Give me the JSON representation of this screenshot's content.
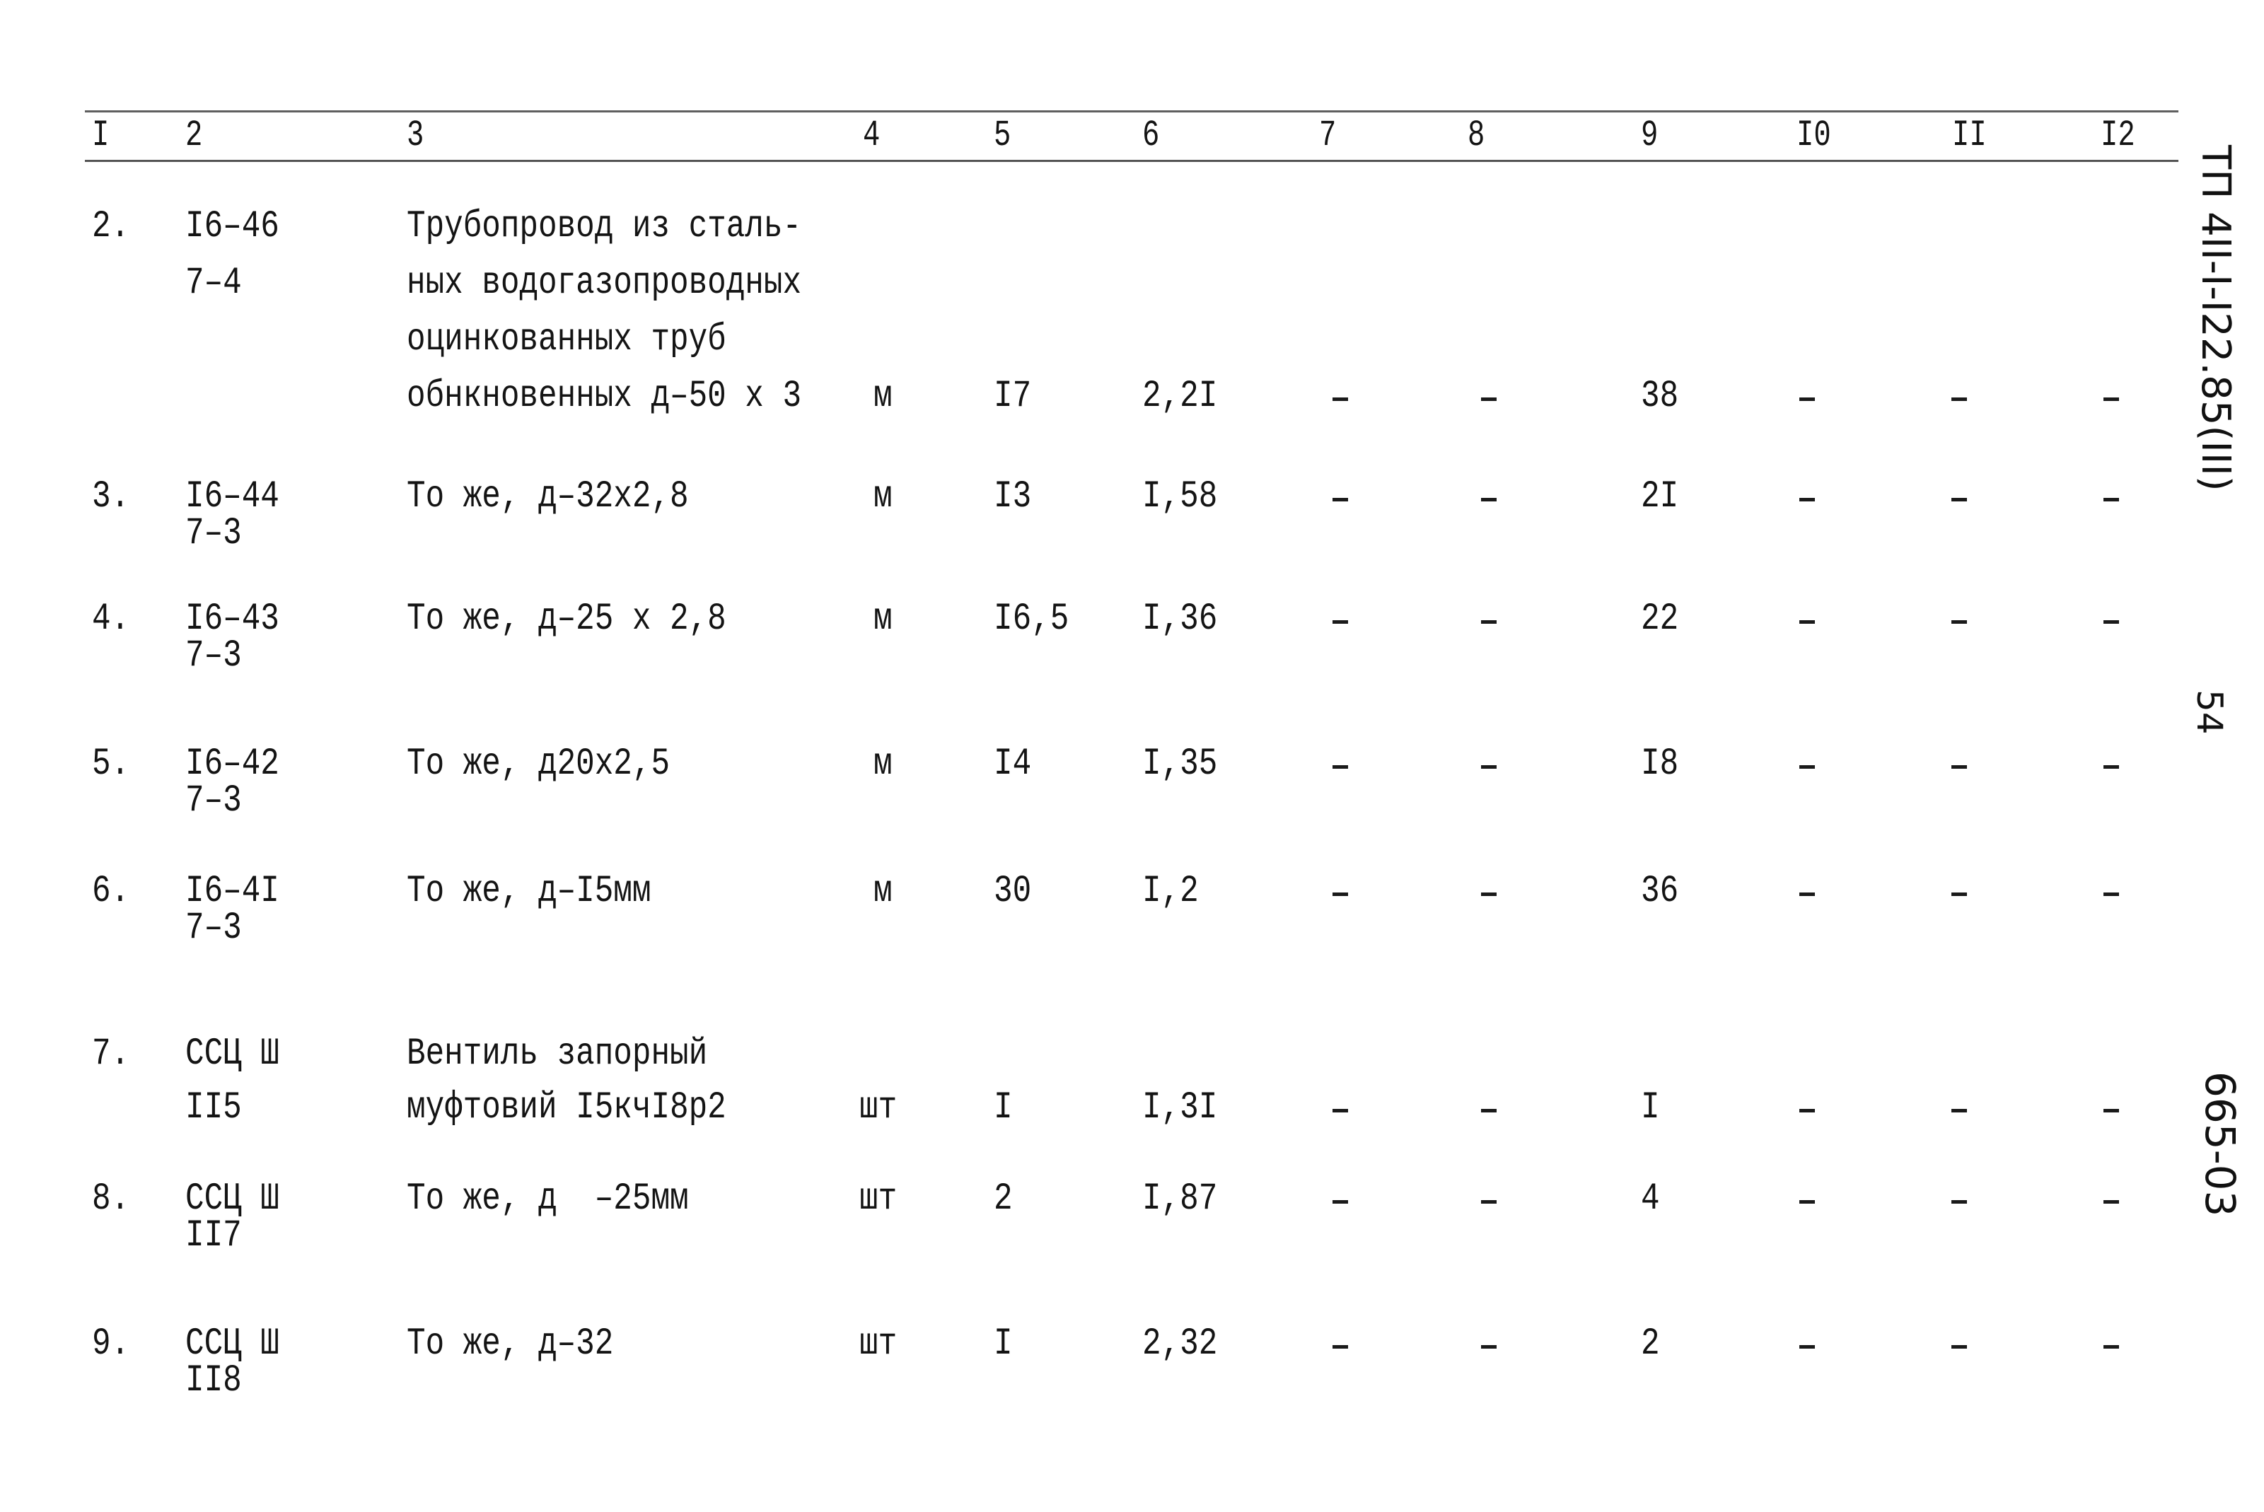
{
  "header": {
    "columns": [
      "I",
      "2",
      "3",
      "4",
      "5",
      "6",
      "7",
      "8",
      "9",
      "I0",
      "II",
      "I2"
    ]
  },
  "rows": [
    {
      "num": "2.",
      "code": [
        "I6–46",
        "7–4"
      ],
      "desc": [
        "Трубопровод из сталь-",
        "ных водогазопроводных",
        "оцинкованных труб",
        "обнкновенных д–50 х 3"
      ],
      "unit": "м",
      "qty": "I7",
      "c6": "2,2I",
      "c7": "–",
      "c8": "–",
      "c9": "38",
      "c10": "–",
      "c11": "–",
      "c12": "–"
    },
    {
      "num": "3.",
      "code": [
        "I6–44",
        "7–3"
      ],
      "desc": [
        "То же, д–32х2,8"
      ],
      "unit": "м",
      "qty": "I3",
      "c6": "I,58",
      "c7": "–",
      "c8": "–",
      "c9": "2I",
      "c10": "–",
      "c11": "–",
      "c12": "–"
    },
    {
      "num": "4.",
      "code": [
        "I6–43",
        "7–3"
      ],
      "desc": [
        "То же, д–25 х 2,8"
      ],
      "unit": "м",
      "qty": "I6,5",
      "c6": "I,36",
      "c7": "–",
      "c8": "–",
      "c9": "22",
      "c10": "–",
      "c11": "–",
      "c12": "–"
    },
    {
      "num": "5.",
      "code": [
        "I6–42",
        "7–3"
      ],
      "desc": [
        "То же, д20х2,5"
      ],
      "unit": "м",
      "qty": "I4",
      "c6": "I,35",
      "c7": "–",
      "c8": "–",
      "c9": "I8",
      "c10": "–",
      "c11": "–",
      "c12": "–"
    },
    {
      "num": "6.",
      "code": [
        "I6–4I",
        "7–3"
      ],
      "desc": [
        "То же, д–I5мм"
      ],
      "unit": "м",
      "qty": "30",
      "c6": "I,2",
      "c7": "–",
      "c8": "–",
      "c9": "36",
      "c10": "–",
      "c11": "–",
      "c12": "–"
    },
    {
      "num": "7.",
      "code": [
        "ССЦ Ш",
        "II5"
      ],
      "desc": [
        "Вентиль запорный",
        "муфтовий I5кчI8р2"
      ],
      "unit": "шт",
      "qty": "I",
      "c6": "I,3I",
      "c7": "–",
      "c8": "–",
      "c9": "I",
      "c10": "–",
      "c11": "–",
      "c12": "–"
    },
    {
      "num": "8.",
      "code": [
        "ССЦ Ш",
        "II7"
      ],
      "desc": [
        "То же, д  –25мм"
      ],
      "unit": "шт",
      "qty": "2",
      "c6": "I,87",
      "c7": "–",
      "c8": "–",
      "c9": "4",
      "c10": "–",
      "c11": "–",
      "c12": "–"
    },
    {
      "num": "9.",
      "code": [
        "ССЦ Ш",
        "II8"
      ],
      "desc": [
        "То же, д–32"
      ],
      "unit": "шт",
      "qty": "I",
      "c6": "2,32",
      "c7": "–",
      "c8": "–",
      "c9": "2",
      "c10": "–",
      "c11": "–",
      "c12": "–"
    }
  ],
  "margin": {
    "doc_code": "ТП 4II-I-I22.85(III)",
    "page_number": "54",
    "sheet_code": "665-03"
  }
}
